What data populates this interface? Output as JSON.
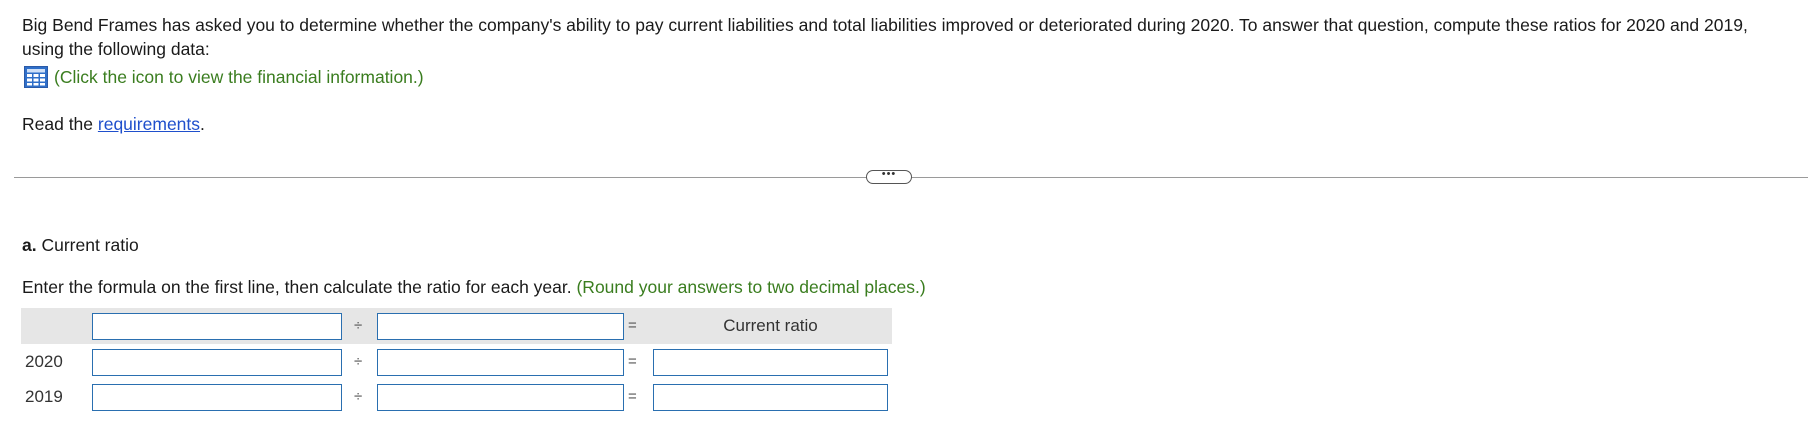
{
  "intro": "Big Bend Frames has asked you to determine whether the company's ability to pay current liabilities and total liabilities improved or deteriorated during 2020. To answer that question, compute these ratios for 2020 and 2019, using the following data:",
  "financial_link": "(Click the icon to view the financial information.)",
  "read": {
    "prefix": "Read the ",
    "link": "requirements",
    "suffix": "."
  },
  "more_button": "•••",
  "part": {
    "letter": "a.",
    "title": " Current ratio"
  },
  "instruction": {
    "text": "Enter the formula on the first line, then calculate the ratio for each year. ",
    "hint": "(Round your answers to two decimal places.)"
  },
  "table": {
    "divide_symbol": "÷",
    "equals_symbol": "=",
    "result_header": "Current ratio",
    "rows": [
      {
        "year": "2020"
      },
      {
        "year": "2019"
      }
    ]
  },
  "colors": {
    "link": "#1f4fcc",
    "hint": "#3a7d1f",
    "input_border": "#2a6fb0",
    "header_bg": "#e6e6e6"
  }
}
